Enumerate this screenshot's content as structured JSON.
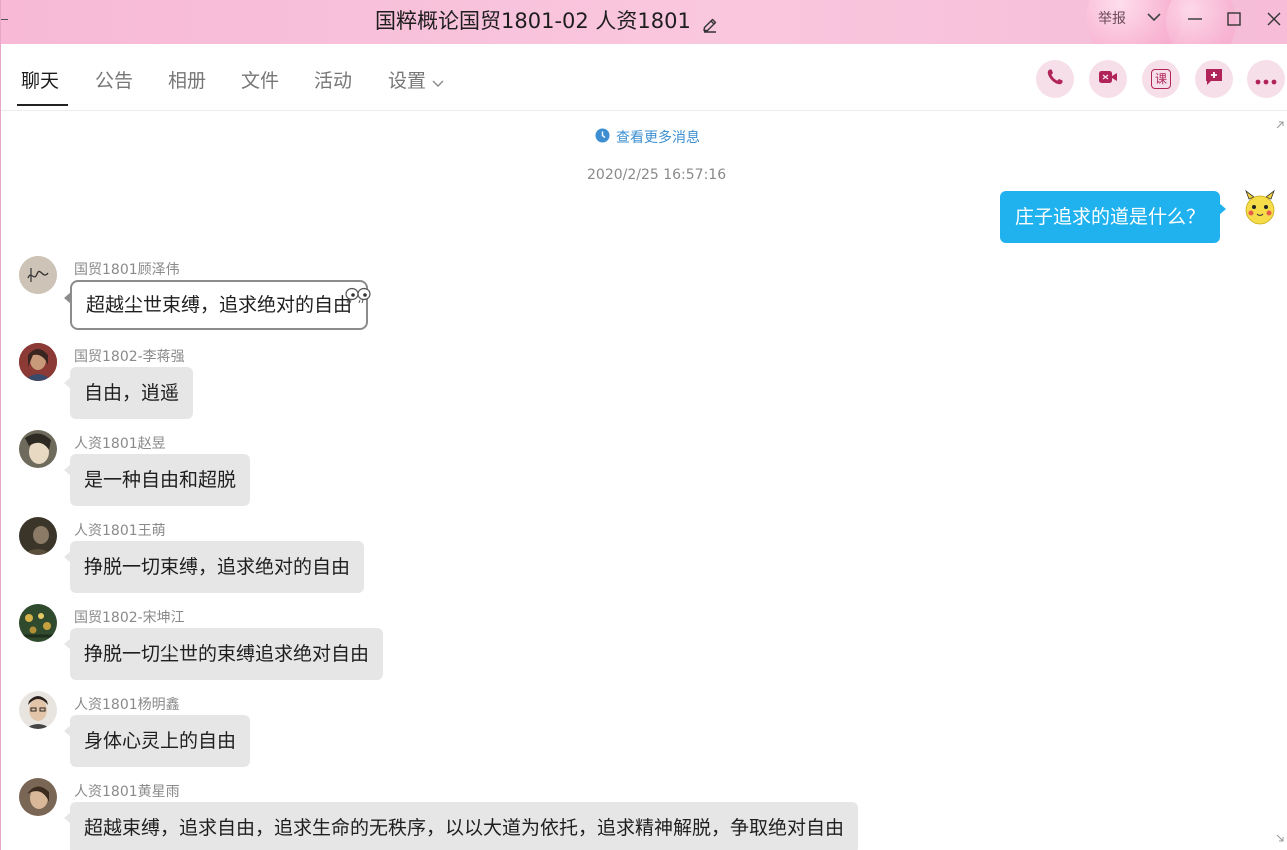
{
  "window": {
    "title": "国粹概论国贸1801-02 人资1801",
    "report_label": "举报"
  },
  "nav": {
    "tabs": [
      {
        "label": "聊天",
        "active": true
      },
      {
        "label": "公告"
      },
      {
        "label": "相册"
      },
      {
        "label": "文件"
      },
      {
        "label": "活动"
      },
      {
        "label": "设置"
      }
    ],
    "actions": [
      "phone-icon",
      "video-call-icon",
      "course-icon",
      "add-message-icon",
      "more-icon"
    ],
    "course_label": "课"
  },
  "chat": {
    "more_messages": "查看更多消息",
    "timestamp": "2020/2/25 16:57:16",
    "my_message": "庄子追求的道是什么？",
    "messages": [
      {
        "sender": "国贸1801顾泽伟",
        "text": "超越尘世束缚，追求绝对的自由"
      },
      {
        "sender": "国贸1802-李蒋强",
        "text": "自由，逍遥"
      },
      {
        "sender": "人资1801赵昱",
        "text": "是一种自由和超脱"
      },
      {
        "sender": "人资1801王萌",
        "text": "挣脱一切束缚，追求绝对的自由"
      },
      {
        "sender": "国贸1802-宋坤江",
        "text": "挣脱一切尘世的束缚追求绝对自由"
      },
      {
        "sender": "人资1801杨明鑫",
        "text": "身体心灵上的自由"
      },
      {
        "sender": "人资1801黄星雨",
        "text": "超越束缚，追求自由，追求生命的无秩序，以以大道为依托，追求精神解脱，争取绝对自由"
      }
    ]
  },
  "colors": {
    "accent": "#1fb2ef",
    "titlebar_pink": "#f7b9d6",
    "action_button_bg": "#f6dfe9",
    "action_icon": "#b0245a",
    "link_blue": "#3d8fd2"
  }
}
